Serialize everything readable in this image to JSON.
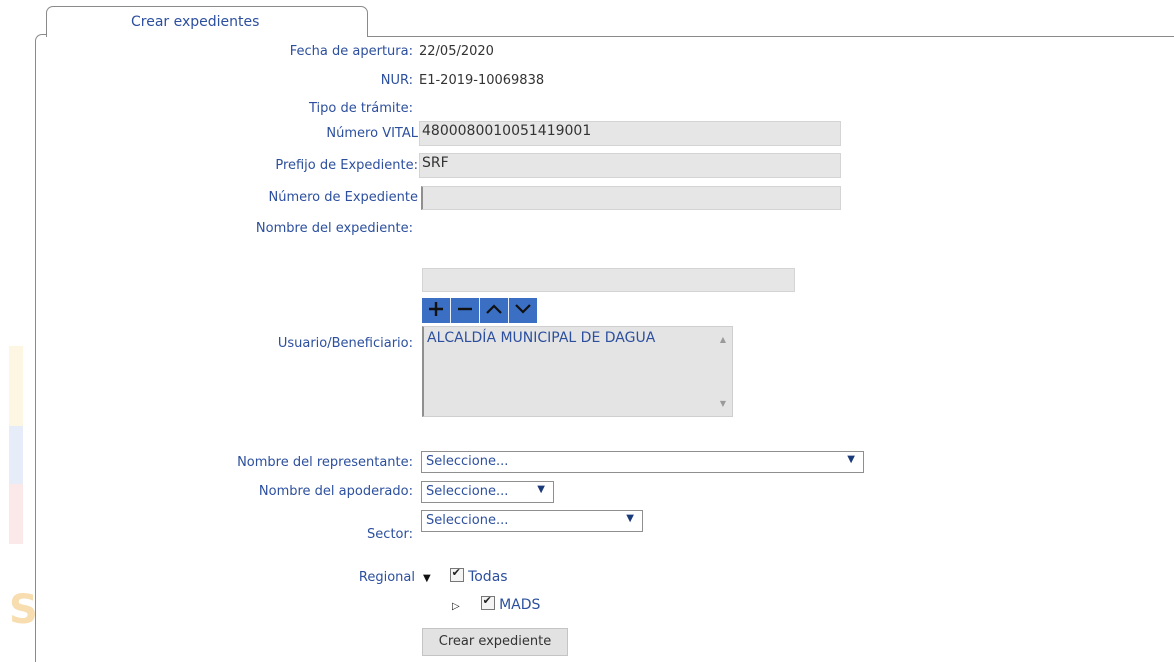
{
  "tab": {
    "label": "Crear expedientes"
  },
  "form": {
    "fecha_label": "Fecha de apertura:",
    "fecha_value": "22/05/2020",
    "nur_label": "NUR:",
    "nur_value": "E1-2019-10069838",
    "tipo_label": "Tipo de trámite:",
    "vital_label": "Número VITAL",
    "vital_value": "4800080010051419001",
    "prefijo_label": "Prefijo de Expediente:",
    "prefijo_value": "SRF",
    "numero_label": "Número de Expediente",
    "numero_value": "",
    "nombre_label": "Nombre del expediente:",
    "usuario_label": "Usuario/Beneficiario:",
    "usuario_search_value": "",
    "usuario_items": [
      "ALCALDÍA MUNICIPAL DE DAGUA"
    ],
    "representante_label": "Nombre del representante:",
    "representante_value": "Seleccione...",
    "apoderado_label": "Nombre del apoderado:",
    "apoderado_value": "Seleccione...",
    "sector_label": "Sector:",
    "sector_value": "Seleccione...",
    "regional_label": "Regional",
    "tree_root": "Todas",
    "tree_child": "MADS",
    "submit_label": "Crear expediente"
  },
  "colors": {
    "label": "#2c4f9e",
    "button_bar": "#3a6fc3",
    "field_bg": "#e6e6e6"
  },
  "icons": [
    "plus-icon",
    "minus-icon",
    "chevron-up-icon",
    "chevron-down-icon",
    "dropdown-arrow-icon",
    "tree-expanded-icon",
    "tree-collapsed-icon",
    "checkbox-checked-icon"
  ]
}
